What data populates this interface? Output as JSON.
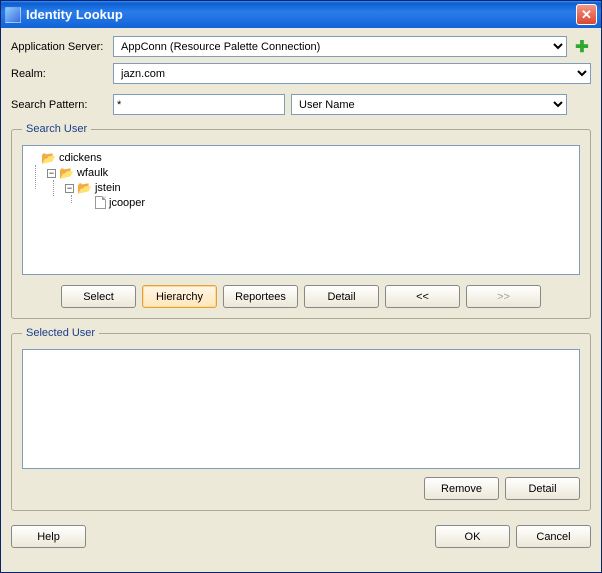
{
  "window": {
    "title": "Identity Lookup"
  },
  "labels": {
    "applicationServer": "Application Server:",
    "realm": "Realm:",
    "searchPattern": "Search Pattern:"
  },
  "fields": {
    "applicationServer": "AppConn (Resource Palette Connection)",
    "realm": "jazn.com",
    "pattern": "*",
    "searchType": "User Name"
  },
  "groups": {
    "searchUser": "Search User",
    "selectedUser": "Selected User"
  },
  "tree": {
    "n0": "cdickens",
    "n1": "wfaulk",
    "n2": "jstein",
    "n3": "jcooper"
  },
  "buttons": {
    "select": "Select",
    "hierarchy": "Hierarchy",
    "reportees": "Reportees",
    "detail": "Detail",
    "prev": "<<",
    "next": ">>",
    "remove": "Remove",
    "help": "Help",
    "ok": "OK",
    "cancel": "Cancel"
  }
}
